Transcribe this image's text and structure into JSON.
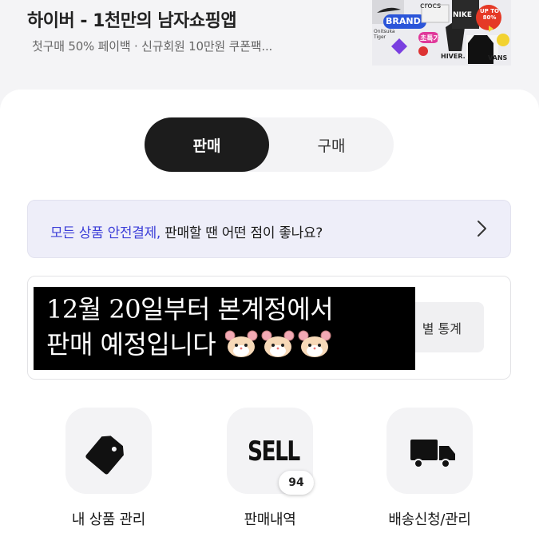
{
  "ad": {
    "title": "하이버 - 1천만의 남자쇼핑앱",
    "subtitle": "첫구매 50% 페이백 · 신규회원 10만원 쿠폰팩...",
    "banner": {
      "brand": "BRAND",
      "crocs": "crocs",
      "nike": "NIKE",
      "sale": "UP TO 80%",
      "special": "초특가",
      "hiver": "HIVER.",
      "vans": "VANS",
      "onitsuka": "Onitsuka Tiger"
    }
  },
  "tabs": {
    "sell": "판매",
    "buy": "구매"
  },
  "info_banner": {
    "highlight": "모든 상품 안전결제,",
    "text": " 판매할 땐 어떤 점이 좋나요?",
    "chevron_icon": "chevron-right-icon"
  },
  "stats": {
    "button_label": "별 통계"
  },
  "overlay": {
    "line1": "12월 20일부터 본계정에서",
    "line2": "판매 예정입니다",
    "emoji": "hamster-face x3"
  },
  "quick_menu": [
    {
      "label": "내 상품 관리",
      "icon": "tag-icon"
    },
    {
      "label": "판매내역",
      "icon": "sell-text-icon",
      "icon_text": "SELL",
      "badge": "94"
    },
    {
      "label": "배송신청/관리",
      "icon": "truck-icon"
    }
  ],
  "colors": {
    "accent": "#3d3fd8",
    "tab_active_bg": "#1c1c1c",
    "info_bg": "#eeeef9"
  }
}
